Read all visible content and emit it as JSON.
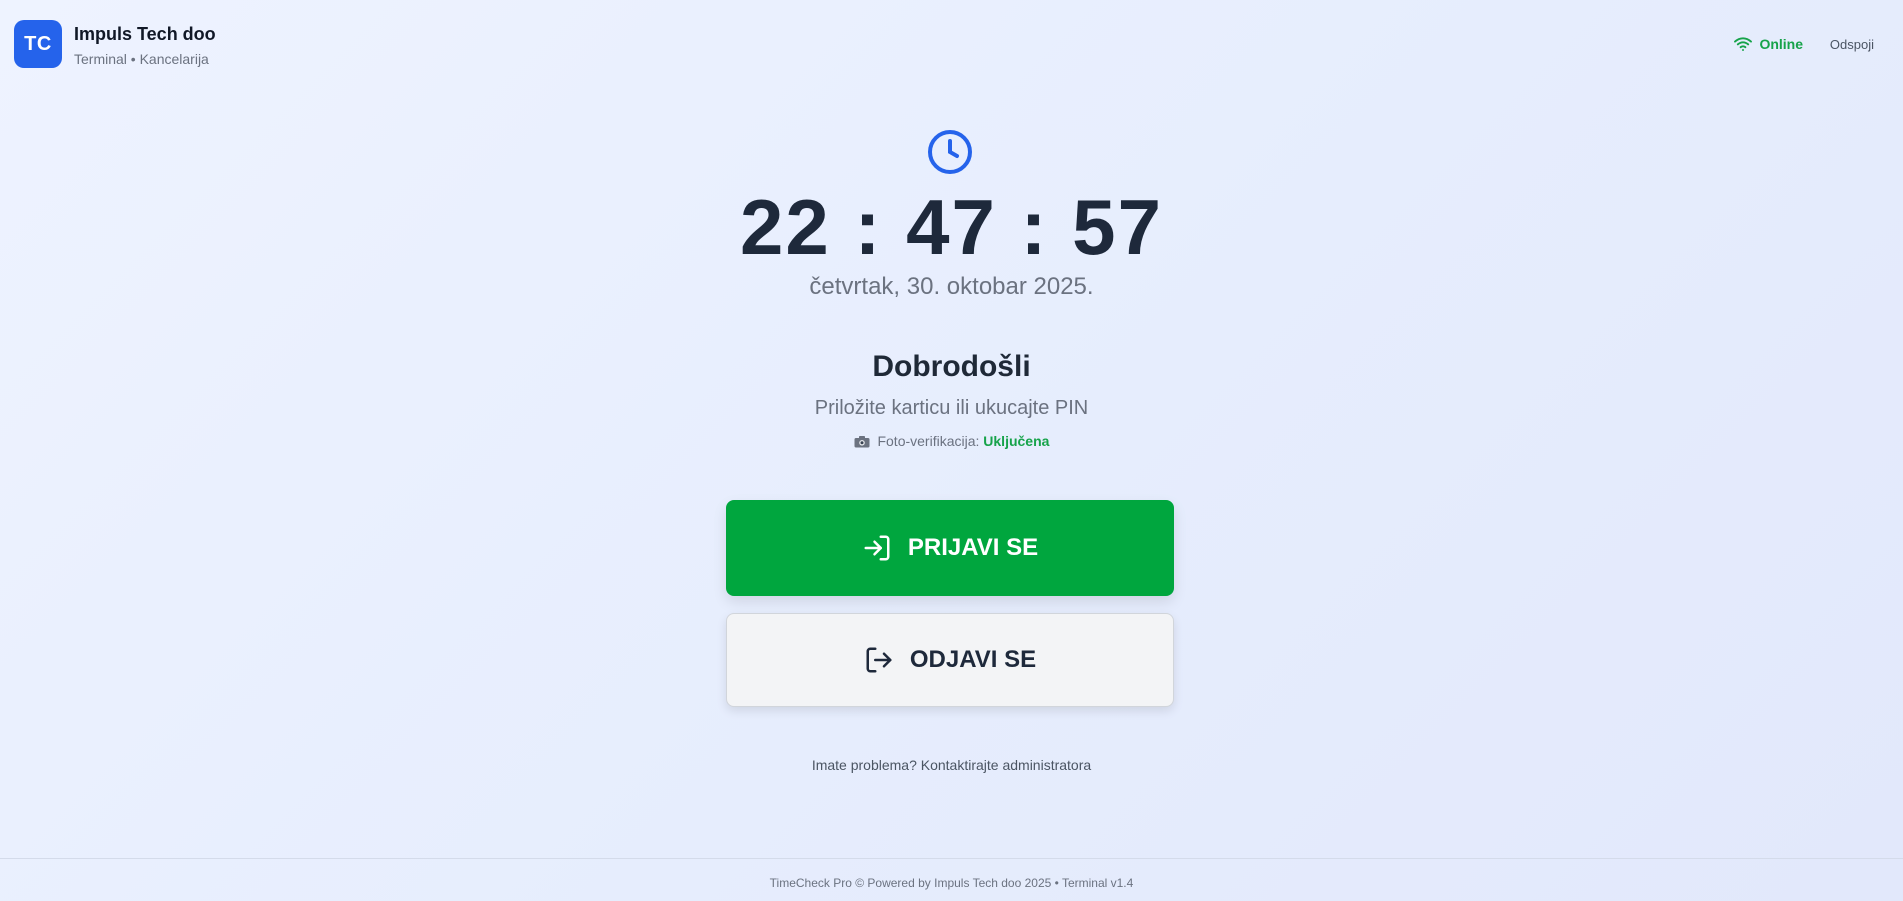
{
  "header": {
    "logo_text": "TC",
    "company": "Impuls Tech doo",
    "subtitle": "Terminal • Kancelarija",
    "status": "Online",
    "disconnect": "Odspoji"
  },
  "clock": {
    "time": "22 : 47 : 57",
    "date": "četvrtak, 30. oktobar 2025."
  },
  "welcome": {
    "title": "Dobrodošli",
    "instruction": "Priložite karticu ili ukucajte PIN",
    "photo_label": "Foto-verifikacija:",
    "photo_status": "Uključena"
  },
  "actions": {
    "checkin": "PRIJAVI SE",
    "checkout": "ODJAVI SE"
  },
  "help": "Imate problema? Kontaktirajte administratora",
  "footer": "TimeCheck Pro © Powered by Impuls Tech doo 2025 • Terminal v1.4",
  "colors": {
    "brand": "#2563eb",
    "success": "#00a63e",
    "online": "#16a34a"
  },
  "icons": [
    "clock-icon",
    "wifi-icon",
    "camera-icon",
    "login-icon",
    "logout-icon"
  ]
}
